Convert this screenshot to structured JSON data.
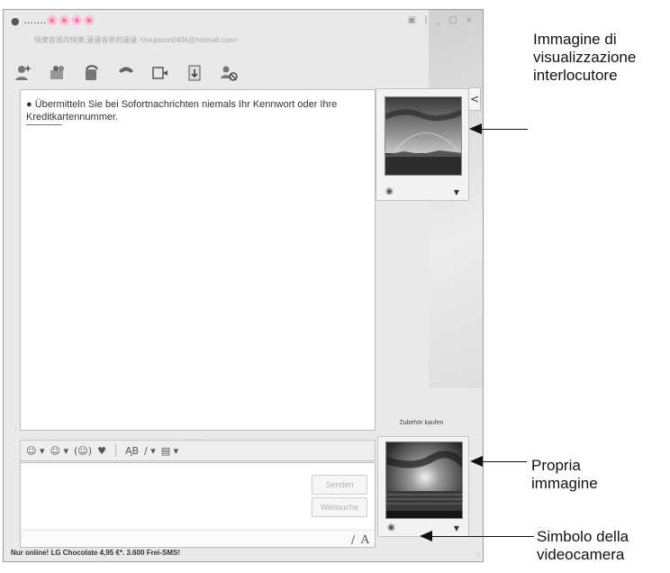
{
  "window": {
    "title": "…….🌸🌸🌸🌸",
    "subtitle": "快樂容易的快樂,遠遠容易的遠遠 <hsujason0406@hotmail.com>",
    "controls": "▣ | _ □ ×"
  },
  "toolbar": {
    "icons": [
      "add-contact-icon",
      "share-folder-icon",
      "phone-icon",
      "handset-icon",
      "video-call-icon",
      "send-file-icon",
      "block-icon"
    ]
  },
  "conversation": {
    "warning": "Übermitteln Sie bei Sofortnachrichten niemals Ihr Kennwort oder Ihre Kreditkartennummer."
  },
  "splitter": ".........",
  "format_bar": {
    "emoticon": "☺ ▾",
    "wink": "☺ ▾",
    "nudge": "(☺)",
    "sound": "♥",
    "font_style": "A̧B",
    "brush": "∕ ▾",
    "background": "▤ ▾"
  },
  "compose": {
    "send_label": "Senden",
    "search_label": "Websuche",
    "pen": "∕",
    "font": "A"
  },
  "status_bar": "Nur online! LG Chocolate 4,95 €*. 3.600 Frei-SMS!",
  "sidebar": {
    "toggle": "<",
    "buy_link": "Zubehör kaufen",
    "cam_glyph": "◉",
    "dropdown_glyph": "▼"
  },
  "callouts": {
    "partner_image": [
      "Immagine di",
      "visualizzazione",
      "interlocutore"
    ],
    "own_image": [
      "Propria",
      "immagine"
    ],
    "camera_symbol": [
      "Simbolo della",
      "videocamera"
    ]
  }
}
